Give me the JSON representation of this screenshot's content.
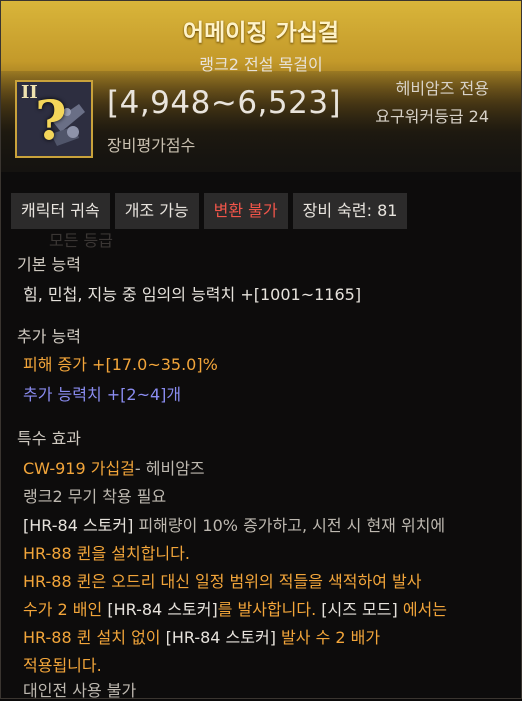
{
  "item": {
    "name": "어메이징 가십걸",
    "subtitle": "랭크2 전설 목걸이",
    "rank_icon_text": "II",
    "unknown_mark": "?",
    "score": "[4,948~6,523]",
    "score_label": "장비평가점수",
    "class_only": "헤비암즈 전용",
    "required_level": "요구워커등급 24"
  },
  "tags": [
    "캐릭터 귀속",
    "개조 가능",
    "변환 불가",
    "장비 숙련: 81"
  ],
  "basic_stats": {
    "title": "기본 능력",
    "line": "힘, 민첩, 지능 중 임의의 능력치 +[1001~1165]"
  },
  "additional_stats": {
    "title": "추가 능력",
    "damage_increase": "피해 증가  +[17.0~35.0]%",
    "extra_count": "추가 능력치 +[2~4]개"
  },
  "special_effect": {
    "title": "특수 효과",
    "set_item_name": "CW-919 가십걸",
    "set_item_suffix": "- 헤비암즈",
    "weapon_req": "랭크2 무기 착용 필요",
    "desc_1a": "[HR-84 스토커]",
    "desc_1b": " 피해량이 10% 증가하고, 시전 시 현재 위치에",
    "desc_2a": "HR-88 퀸",
    "desc_2b": "을 설치합니다.",
    "desc_3a": "HR-88 퀸",
    "desc_3b": "은 오드리 대신 일정 범위의 적들을 색적하여 발사",
    "desc_4a": "수가 2 배인 ",
    "desc_4b": "[HR-84 스토커]",
    "desc_4c": "를 발사합니다. ",
    "desc_4d": "[시즈 모드]",
    "desc_4e": " 에서는",
    "desc_5a": "HR-88 퀸",
    "desc_5b": " 설치 없이 ",
    "desc_5c": "[HR-84 스토커]",
    "desc_5d": " 발사 수 2 배가",
    "desc_6": "적용됩니다.",
    "pvp_note": "대인전 사용 불가"
  },
  "colors": {
    "header_gold": "#d9b53a",
    "orange": "#f2a53a",
    "blue": "#8a8cf0",
    "red": "#f0554a"
  }
}
